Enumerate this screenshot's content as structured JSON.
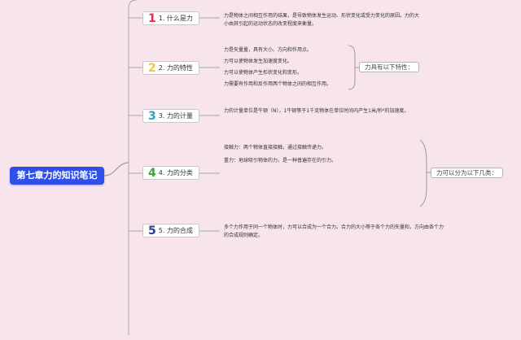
{
  "root": {
    "title": "第七章力的知识笔记"
  },
  "topics": [
    {
      "num": "1",
      "label": "1. 什么是力",
      "color": "#e0304e",
      "desc": [
        "力是物体之间相互作用的结果，是导致物体发生运动、形状变化或受力变化的原因。力的大小由其引起的运动状态的改变程度来衡量。"
      ]
    },
    {
      "num": "2",
      "label": "2. 力的特性",
      "color": "#f5c431",
      "desc": [
        "力是矢量量，具有大小、方向和作用点。",
        "力可以使物体发生加速度变化。",
        "力可以使物体产生形状变化和变形。",
        "力需要有作用和反作用两个物体之间的相互作用。"
      ],
      "note": "力具有以下特性："
    },
    {
      "num": "3",
      "label": "3. 力的计量",
      "color": "#2aa3c9",
      "desc": [
        "力的计量单位是牛顿（N），1牛顿等于1千克物体在单位时间内产生1米/秒²的加速度。"
      ]
    },
    {
      "num": "4",
      "label": "4. 力的分类",
      "color": "#3aa636",
      "desc": [
        "接触力：两个物体直接接触，通过接触传递力。",
        "重力：地球吸引物体的力，是一种普遍存在的引力。"
      ],
      "note": "力可以分为以下几类："
    },
    {
      "num": "5",
      "label": "5. 力的合成",
      "color": "#2a3f8f",
      "desc": [
        "多个力作用于同一个物体时，力可以合成为一个合力。合力的大小等于各个力的矢量和，方向由各个力的合成规则确定。"
      ]
    }
  ]
}
